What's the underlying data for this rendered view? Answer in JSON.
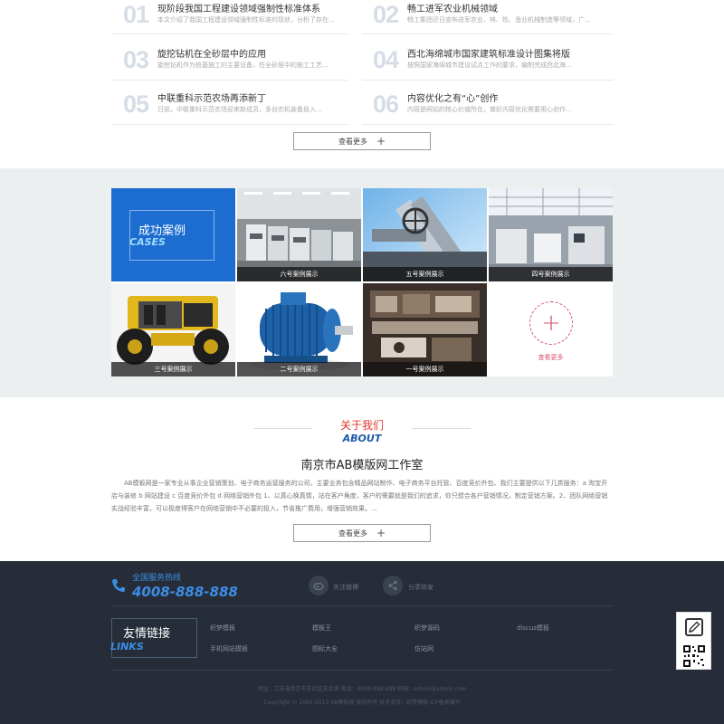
{
  "news": {
    "items": [
      {
        "num": "01",
        "title": "现阶段我国工程建设领域强制性标准体系",
        "desc": "本文介绍了我国工程建设领域强制性标准的现状，分析了存在..."
      },
      {
        "num": "02",
        "title": "畅工进军农业机械领域",
        "desc": "畅工集团近日宣布进军农业、林、牧、渔业机械制造等领域，广..."
      },
      {
        "num": "03",
        "title": "旋挖钻机在全砂层中的应用",
        "desc": "旋挖钻机作为桩基施工的主要设备，在全砂层中的施工工艺..."
      },
      {
        "num": "04",
        "title": "西北海绵城市国家建筑标准设计图集将版",
        "desc": "按照国家海绵城市建设试点工作的要求，编制完成西北海..."
      },
      {
        "num": "05",
        "title": "中联重科示范农场再添新丁",
        "desc": "日前，中联重科示范农场迎来新成员，多台农机装备投入..."
      },
      {
        "num": "06",
        "title": "内容优化之有“心”创作",
        "desc": "内容是网站的核心价值所在，做好内容优化需要用心创作..."
      }
    ],
    "more_label": "查看更多"
  },
  "cases": {
    "title_cn": "成功案例",
    "title_en": "CASES",
    "items": [
      {
        "label": "六号案例展示"
      },
      {
        "label": "五号案例展示"
      },
      {
        "label": "四号案例展示"
      },
      {
        "label": "三号案例展示"
      },
      {
        "label": "二号案例展示"
      },
      {
        "label": "一号案例展示"
      }
    ],
    "more_label": "查看更多"
  },
  "about": {
    "title_cn": "关于我们",
    "title_en": "ABOUT",
    "company": "南京市AB模版网工作室",
    "text": "AB模板网是一家专业从事企业营销策划、电子商务运营服务的公司，主要业务包含精品网站制作、电子商务平台托管、百度竞价外包、我们主要提供以下几类服务：a 淘宝开店与装修 b 网站建设 c 百度竞价外包 d 网络营销外包 1、以真心换真情，站在客户角度，客户的需要就是我们的追求，你只想合各户营销情况，制定营销方案。2、团队网络营销实战经验丰富，可以极度得客户在网络营销中不必要的投入，节省推广费用，增强营销效果。...",
    "more_label": "查看更多"
  },
  "footer": {
    "hotline_label": "全国服务热线",
    "hotline_number": "4008-888-888",
    "social": [
      {
        "label": "关注微博"
      },
      {
        "label": "分享转发"
      }
    ],
    "links_cn": "友情链接",
    "links_en": "LINKS",
    "links": [
      {
        "label": "织梦模板"
      },
      {
        "label": "模板王"
      },
      {
        "label": "织梦源码"
      },
      {
        "label": "discuz模板"
      },
      {
        "label": "手机网站模板"
      },
      {
        "label": "图标大全"
      },
      {
        "label": "仿站网"
      }
    ],
    "copyright_line1": "地址：江苏省南京市玄武区玄武湖    电话：4008-888-888    邮箱：admin@admin.com",
    "copyright_line2": "Copyright © 2002-2019 AB模板网 版权所有    技术支持：织梦模板    ICP备案编号"
  },
  "colors": {
    "accent_blue": "#1c6dcf",
    "footer_bg": "#262d38",
    "about_red": "#e2352b"
  }
}
